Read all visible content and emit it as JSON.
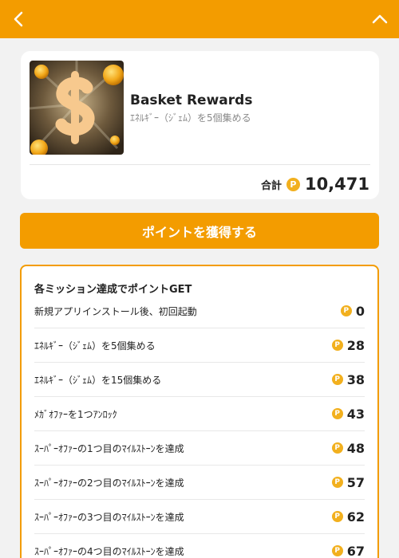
{
  "app": {
    "title": "Basket Rewards",
    "subtitle": "ｴﾈﾙｷﾞｰ（ｼﾞｪﾑ）を5個集める"
  },
  "total": {
    "label": "合計",
    "value": "10,471"
  },
  "cta": {
    "label": "ポイントを獲得する"
  },
  "missions": {
    "heading": "各ミッション達成でポイントGET",
    "items": [
      {
        "label": "新規アプリインストール後、初回起動",
        "points": "0"
      },
      {
        "label": "ｴﾈﾙｷﾞｰ（ｼﾞｪﾑ）を5個集める",
        "points": "28"
      },
      {
        "label": "ｴﾈﾙｷﾞｰ（ｼﾞｪﾑ）を15個集める",
        "points": "38"
      },
      {
        "label": "ﾒｶﾞｵﾌｧｰを1つｱﾝﾛｯｸ",
        "points": "43"
      },
      {
        "label": "ｽｰﾊﾟｰｵﾌｧｰの1つ目のﾏｲﾙｽﾄｰﾝを達成",
        "points": "48"
      },
      {
        "label": "ｽｰﾊﾟｰｵﾌｧｰの2つ目のﾏｲﾙｽﾄｰﾝを達成",
        "points": "57"
      },
      {
        "label": "ｽｰﾊﾟｰｵﾌｧｰの3つ目のﾏｲﾙｽﾄｰﾝを達成",
        "points": "62"
      },
      {
        "label": "ｽｰﾊﾟｰｵﾌｧｰの4つ目のﾏｲﾙｽﾄｰﾝを達成",
        "points": "67"
      }
    ]
  },
  "colors": {
    "accent": "#f39c00",
    "coin": "#f2b01e",
    "background": "#f2f2f2"
  },
  "icons": {
    "back": "chevron-left-icon",
    "collapse": "chevron-up-icon",
    "coin": "point-coin-icon",
    "thumbnail": "dollar-coin-thumbnail"
  },
  "coin_glyph": "P"
}
